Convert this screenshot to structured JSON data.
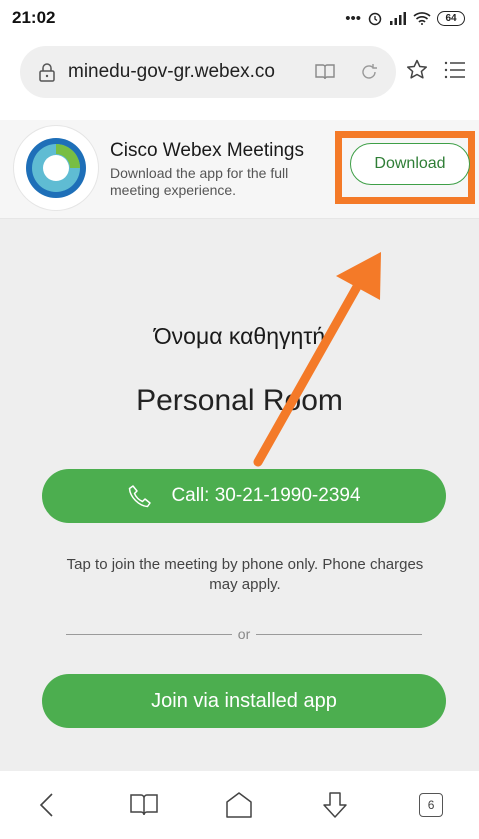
{
  "status_bar": {
    "time": "21:02",
    "battery": "64"
  },
  "browser": {
    "url": "minedu-gov-gr.webex.co"
  },
  "app_banner": {
    "app_name": "Cisco Webex Meetings",
    "description": "Download the app for the full meeting experience.",
    "download_label": "Download"
  },
  "meeting": {
    "host_name": "Όνομα καθηγητή",
    "room_title": "Personal Room",
    "call_label": "Call: 30-21-1990-2394",
    "call_info": "Tap to join the meeting by phone only. Phone charges may apply.",
    "or_label": "or",
    "join_label": "Join via installed app"
  },
  "nav": {
    "tab_count": "6"
  },
  "colors": {
    "accent_green": "#4cae4f",
    "highlight_orange": "#f47a28"
  },
  "icons": [
    "lock-icon",
    "reader-icon",
    "reload-icon",
    "star-icon",
    "menu-icon",
    "phone-icon",
    "back-icon",
    "bookmarks-icon",
    "home-icon",
    "downloads-icon",
    "tabs-icon"
  ]
}
